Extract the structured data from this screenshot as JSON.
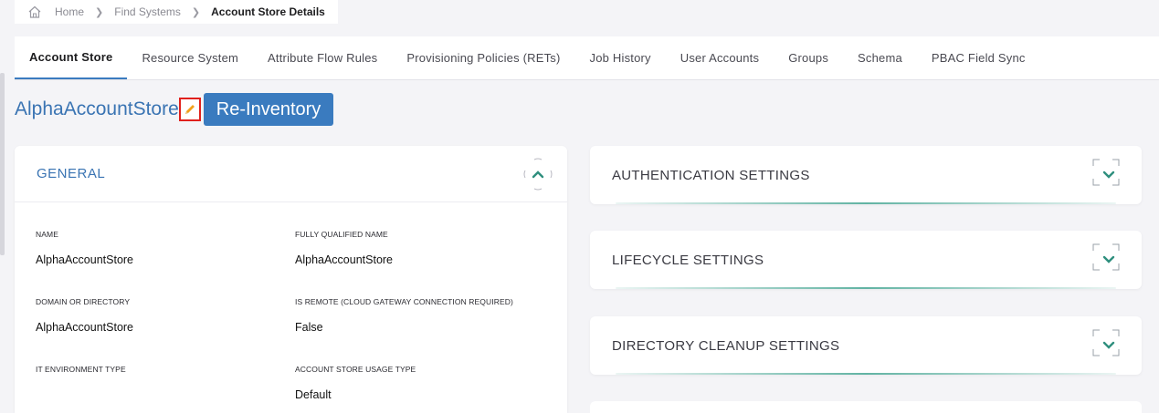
{
  "breadcrumb": {
    "items": [
      "Home",
      "Find Systems",
      "Account Store Details"
    ]
  },
  "tabs": [
    {
      "label": "Account Store",
      "active": true
    },
    {
      "label": "Resource System",
      "active": false
    },
    {
      "label": "Attribute Flow Rules",
      "active": false
    },
    {
      "label": "Provisioning Policies (RETs)",
      "active": false
    },
    {
      "label": "Job History",
      "active": false
    },
    {
      "label": "User Accounts",
      "active": false
    },
    {
      "label": "Groups",
      "active": false
    },
    {
      "label": "Schema",
      "active": false
    },
    {
      "label": "PBAC Field Sync",
      "active": false
    }
  ],
  "header": {
    "title": "AlphaAccountStore",
    "edit_icon": "pencil-icon",
    "reinventory_label": "Re-Inventory"
  },
  "general": {
    "title": "GENERAL",
    "fields": [
      {
        "label": "NAME",
        "value": "AlphaAccountStore"
      },
      {
        "label": "FULLY QUALIFIED NAME",
        "value": "AlphaAccountStore"
      },
      {
        "label": "DOMAIN OR DIRECTORY",
        "value": "AlphaAccountStore"
      },
      {
        "label": "IS REMOTE (CLOUD GATEWAY CONNECTION REQUIRED)",
        "value": "False"
      },
      {
        "label": "IT ENVIRONMENT TYPE",
        "value": ""
      },
      {
        "label": "ACCOUNT STORE USAGE TYPE",
        "value": "Default"
      }
    ]
  },
  "settings": [
    {
      "title": "AUTHENTICATION SETTINGS"
    },
    {
      "title": "LIFECYCLE SETTINGS"
    },
    {
      "title": "DIRECTORY CLEANUP SETTINGS"
    }
  ],
  "colors": {
    "accent": "#3a7bbf",
    "title_blue": "#3a74b3",
    "teal": "#2f8f7e",
    "highlight_red": "#e0201c"
  }
}
